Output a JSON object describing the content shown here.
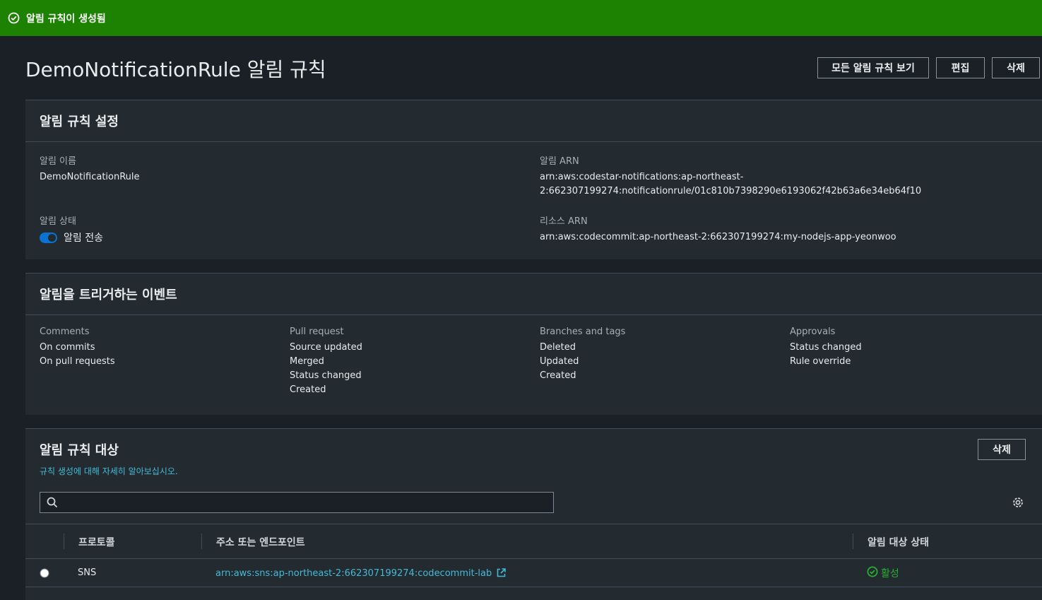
{
  "flash": {
    "message": "알림 규칙이 생성됨",
    "color": "#1d8102"
  },
  "header": {
    "title": "DemoNotificationRule 알림 규칙",
    "buttons": {
      "view_all": "모든 알림 규칙 보기",
      "edit": "편집",
      "delete": "삭제"
    }
  },
  "settings": {
    "title": "알림 규칙 설정",
    "name_label": "알림 이름",
    "name_value": "DemoNotificationRule",
    "arn_label": "알림 ARN",
    "arn_value_line1": "arn:aws:codestar-notifications:ap-northeast-",
    "arn_value_line2": "2:662307199274:notificationrule/01c810b7398290e6193062f42b63a6e34eb64f10",
    "status_label": "알림 상태",
    "status_toggle_label": "알림 전송",
    "status_enabled": true,
    "resource_arn_label": "리소스 ARN",
    "resource_arn_value": "arn:aws:codecommit:ap-northeast-2:662307199274:my-nodejs-app-yeonwoo"
  },
  "events": {
    "title": "알림을 트리거하는 이벤트",
    "groups": [
      {
        "name": "Comments",
        "items": [
          "On commits",
          "On pull requests"
        ]
      },
      {
        "name": "Pull request",
        "items": [
          "Source updated",
          "Merged",
          "Status changed",
          "Created"
        ]
      },
      {
        "name": "Branches and tags",
        "items": [
          "Deleted",
          "Updated",
          "Created"
        ]
      },
      {
        "name": "Approvals",
        "items": [
          "Status changed",
          "Rule override"
        ]
      }
    ]
  },
  "targets": {
    "title": "알림 규칙 대상",
    "learn_more": "규칙 생성에 대해 자세히 알아보십시오.",
    "delete_button": "삭제",
    "search_placeholder": "",
    "columns": {
      "protocol": "프로토콜",
      "endpoint": "주소 또는 엔드포인트",
      "status": "알림 대상 상태"
    },
    "rows": [
      {
        "protocol": "SNS",
        "endpoint": "arn:aws:sns:ap-northeast-2:662307199274:codecommit-lab",
        "status": "활성"
      }
    ]
  },
  "colors": {
    "link": "#44b9d6",
    "success": "#1d8102",
    "active_status": "#29ad32",
    "toggle": "#0972d3"
  },
  "icons": [
    "check-circle-icon",
    "search-icon",
    "gear-icon",
    "external-link-icon",
    "radio-icon"
  ]
}
